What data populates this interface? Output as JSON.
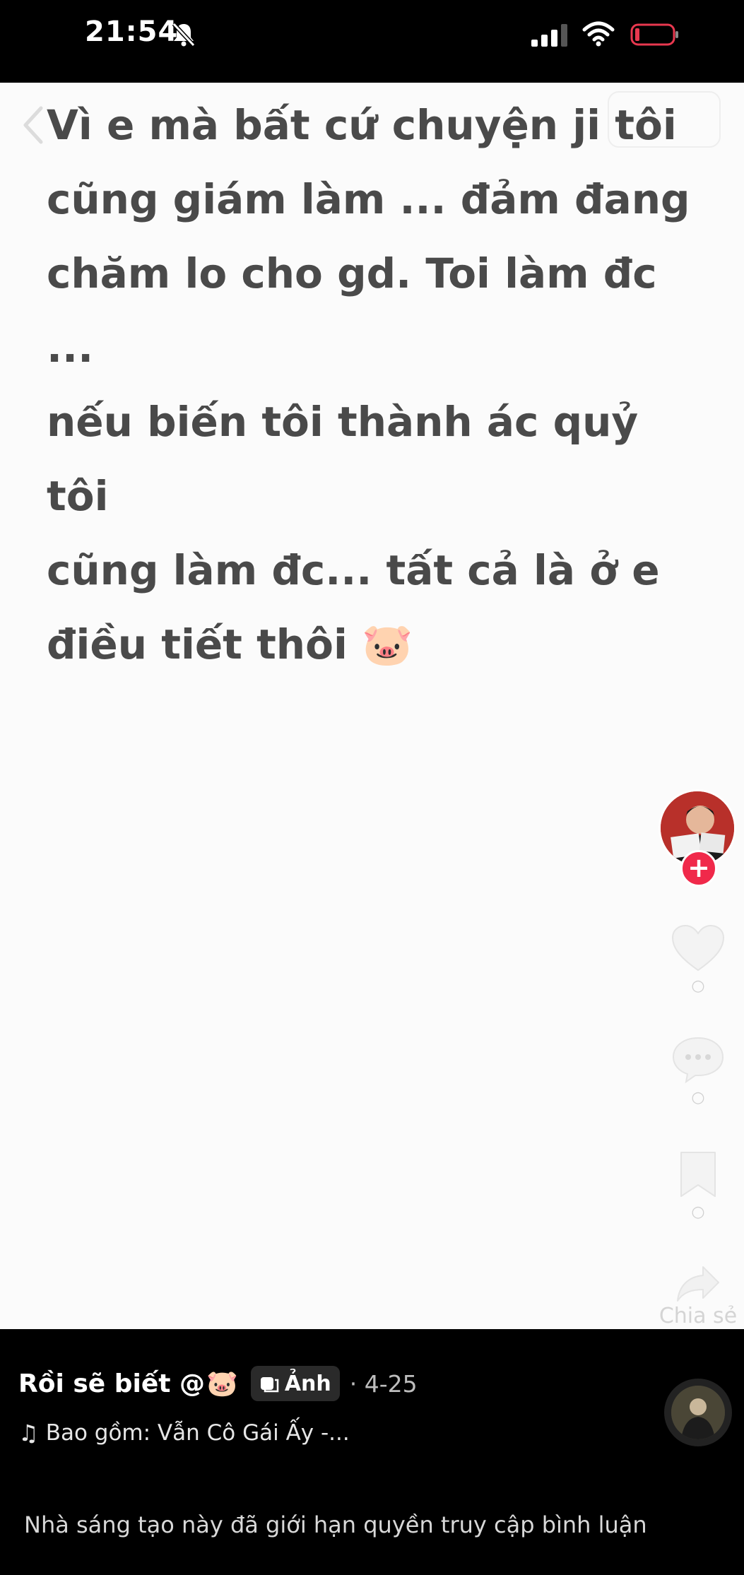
{
  "status_bar": {
    "time": "21:54",
    "icons": [
      "bell-slash-icon",
      "cellular-signal-icon",
      "wifi-icon",
      "battery-icon"
    ],
    "battery_color": "#e8384f"
  },
  "post": {
    "text": "Vì e mà bất cứ chuyện ji tôi\ncũng giám làm ... đảm đang\nchăm lo cho gd. Toi làm đc ...\nnếu biến tôi thành ác quỷ tôi\ncũng làm đc... tất cả là ở e\nđiều tiết thôi",
    "trailing_emoji": "🐷",
    "background": "#fbfbfb",
    "text_color": "#4a4a4a"
  },
  "sidebar": {
    "follow_symbol": "+",
    "follow_color": "#f0294a",
    "share_label": "Chia sẻ",
    "icons": [
      "avatar",
      "heart-icon",
      "comment-icon",
      "bookmark-icon",
      "share-icon"
    ]
  },
  "bottom": {
    "caption_text": "Rồi sẽ biết @",
    "caption_emoji": "🐷",
    "badge_label": "Ảnh",
    "date": "· 4-25",
    "music_note": "♫",
    "music_text": "Bao gồm: Vẫn Cô Gái Ấy -...",
    "comments_notice": "Nhà sáng tạo này đã giới hạn quyền truy cập bình luận"
  }
}
